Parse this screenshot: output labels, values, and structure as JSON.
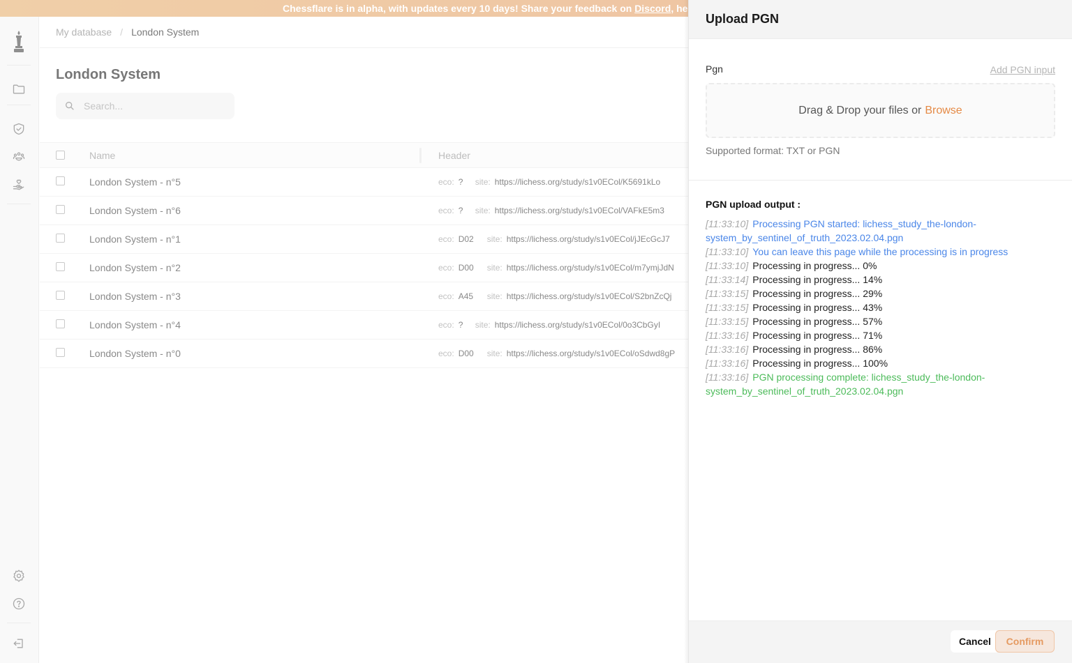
{
  "banner": {
    "text_before": "Chessflare is in alpha, with updates every 10 days! Share your feedback on ",
    "link": "Discord",
    "text_after": ", help sh"
  },
  "sidebar": {
    "items": [
      {
        "icon": "chess-bishop-logo-icon"
      },
      {
        "icon": "folder-icon"
      },
      {
        "icon": "shield-check-icon"
      },
      {
        "icon": "users-group-icon"
      },
      {
        "icon": "heart-hand-icon"
      },
      {
        "icon": "gear-icon"
      },
      {
        "icon": "help-circle-icon"
      },
      {
        "icon": "logout-icon"
      }
    ]
  },
  "breadcrumb": {
    "root": "My database",
    "separator": "/",
    "current": "London System"
  },
  "page": {
    "title": "London System",
    "search_placeholder": "Search..."
  },
  "table": {
    "columns": [
      "Name",
      "Header"
    ],
    "rows": [
      {
        "name": "London System - n°5",
        "eco": "?",
        "site": "https://lichess.org/study/s1v0ECol/K5691kLo"
      },
      {
        "name": "London System - n°6",
        "eco": "?",
        "site": "https://lichess.org/study/s1v0ECol/VAFkE5m3"
      },
      {
        "name": "London System - n°1",
        "eco": "D02",
        "site": "https://lichess.org/study/s1v0ECol/jJEcGcJ7"
      },
      {
        "name": "London System - n°2",
        "eco": "D00",
        "site": "https://lichess.org/study/s1v0ECol/m7ymjJdN"
      },
      {
        "name": "London System - n°3",
        "eco": "A45",
        "site": "https://lichess.org/study/s1v0ECol/S2bnZcQj"
      },
      {
        "name": "London System - n°4",
        "eco": "?",
        "site": "https://lichess.org/study/s1v0ECol/0o3CbGyI"
      },
      {
        "name": "London System - n°0",
        "eco": "D00",
        "site": "https://lichess.org/study/s1v0ECol/oSdwd8gP"
      }
    ],
    "eco_label": "eco:",
    "site_label": "site:"
  },
  "drawer": {
    "title": "Upload PGN",
    "pgn_label": "Pgn",
    "add_input_label": "Add PGN input",
    "dropzone_text": "Drag & Drop your files or",
    "browse_label": "Browse",
    "supported_format": "Supported format: TXT or PGN",
    "output_title": "PGN upload output :",
    "log": [
      {
        "time": "[11:33:10]",
        "type": "info",
        "message": "Processing PGN started: lichess_study_the-london-system_by_sentinel_of_truth_2023.02.04.pgn"
      },
      {
        "time": "[11:33:10]",
        "type": "info",
        "message": "You can leave this page while the processing is in progress"
      },
      {
        "time": "[11:33:10]",
        "type": "normal",
        "message": "Processing in progress... 0%"
      },
      {
        "time": "[11:33:14]",
        "type": "normal",
        "message": "Processing in progress... 14%"
      },
      {
        "time": "[11:33:15]",
        "type": "normal",
        "message": "Processing in progress... 29%"
      },
      {
        "time": "[11:33:15]",
        "type": "normal",
        "message": "Processing in progress... 43%"
      },
      {
        "time": "[11:33:15]",
        "type": "normal",
        "message": "Processing in progress... 57%"
      },
      {
        "time": "[11:33:16]",
        "type": "normal",
        "message": "Processing in progress... 71%"
      },
      {
        "time": "[11:33:16]",
        "type": "normal",
        "message": "Processing in progress... 86%"
      },
      {
        "time": "[11:33:16]",
        "type": "normal",
        "message": "Processing in progress... 100%"
      },
      {
        "time": "[11:33:16]",
        "type": "success",
        "message": "PGN processing complete: lichess_study_the-london-system_by_sentinel_of_truth_2023.02.04.pgn"
      }
    ],
    "cancel_label": "Cancel",
    "confirm_label": "Confirm"
  },
  "colors": {
    "accent": "#e58a46",
    "info": "#4a86e8",
    "success": "#4cbb5a"
  }
}
